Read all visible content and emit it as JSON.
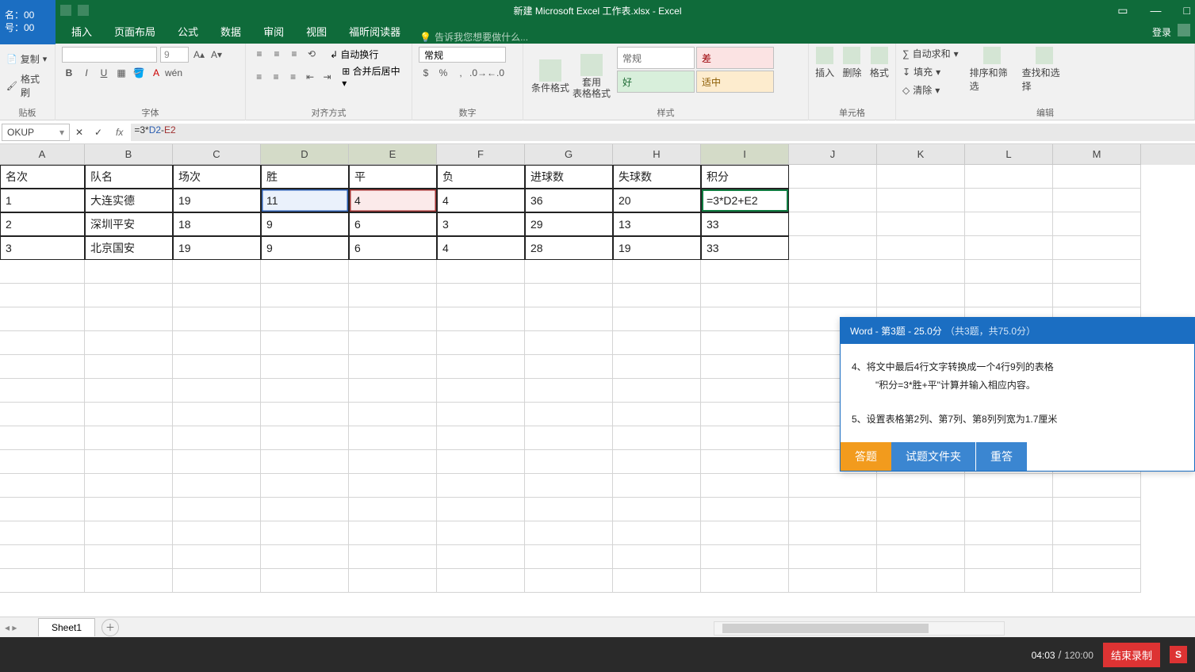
{
  "badge": {
    "l1": "名：00",
    "l2": "号：00"
  },
  "title": "新建 Microsoft Excel 工作表.xlsx - Excel",
  "ribbonTabs": [
    "插入",
    "页面布局",
    "公式",
    "数据",
    "审阅",
    "视图",
    "福昕阅读器"
  ],
  "tellme": "告诉我您想要做什么...",
  "login": "登录",
  "clipboard": {
    "copy": "复制",
    "brush": "格式刷",
    "label": "贴板"
  },
  "font": {
    "size": "9",
    "label": "字体"
  },
  "align": {
    "wrap": "自动换行",
    "merge": "合并后居中",
    "label": "对齐方式"
  },
  "number": {
    "general": "常规",
    "label": "数字"
  },
  "styles": {
    "cf": "条件格式",
    "tf": "套用\n表格格式",
    "c1": "常规",
    "c2": "差",
    "c3": "好",
    "c4": "适中",
    "label": "样式"
  },
  "cells": {
    "ins": "插入",
    "del": "删除",
    "fmt": "格式",
    "label": "单元格"
  },
  "editing": {
    "sum": "自动求和",
    "fill": "填充",
    "clear": "清除",
    "sort": "排序和筛选",
    "find": "查找和选择",
    "label": "编辑"
  },
  "namebox": "OKUP",
  "formula_display": "=3*D2+E2",
  "formula_parts": {
    "pre": "=3",
    "op1": "*",
    "d": "D2",
    "op2": "-",
    "e": "E2"
  },
  "cols": [
    "A",
    "B",
    "C",
    "D",
    "E",
    "F",
    "G",
    "H",
    "I",
    "J",
    "K",
    "L",
    "M"
  ],
  "table": {
    "header": [
      "名次",
      "队名",
      "场次",
      "胜",
      "平",
      "负",
      "进球数",
      "失球数",
      "积分"
    ],
    "rows": [
      [
        "1",
        "大连实德",
        "19",
        "11",
        "4",
        "4",
        "36",
        "20",
        "=3*D2+E2"
      ],
      [
        "2",
        "深圳平安",
        "18",
        "9",
        "6",
        "3",
        "29",
        "13",
        "33"
      ],
      [
        "3",
        "北京国安",
        "19",
        "9",
        "6",
        "4",
        "28",
        "19",
        "33"
      ]
    ]
  },
  "sheet": "Sheet1",
  "question": {
    "title": "Word - 第3题 - 25.0分",
    "sub": "（共3题，共75.0分）",
    "p1": "4、将文中最后4行文字转换成一个4行9列的表格",
    "p2": "\"积分=3*胜+平\"计算并输入相应内容。",
    "p3": "5、设置表格第2列、第7列、第8列列宽为1.7厘米",
    "b1": "答题",
    "b2": "试题文件夹",
    "b3": "重答"
  },
  "time": {
    "cur": "04:03",
    "total": "120:00"
  },
  "endrec": "结束录制"
}
